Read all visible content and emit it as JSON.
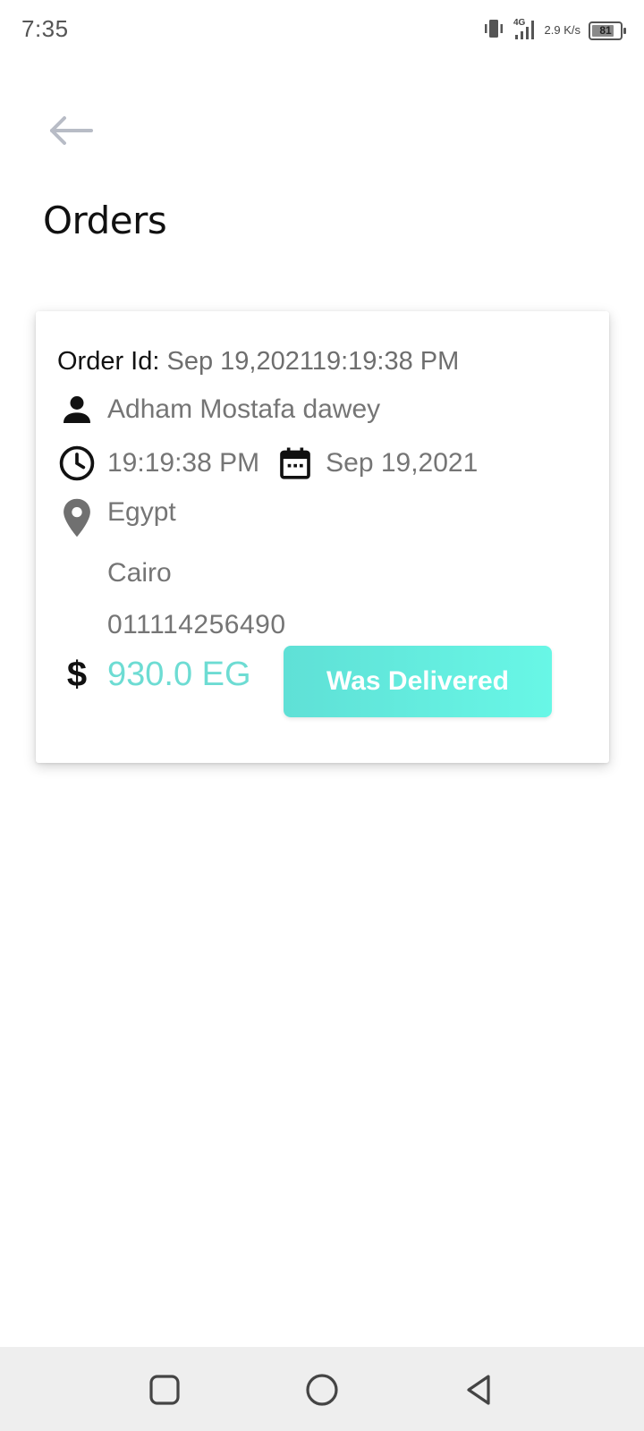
{
  "status_bar": {
    "time": "7:35",
    "network": "4G",
    "speed_value": "2.9",
    "speed_unit": "K/s",
    "battery_level": "81"
  },
  "header": {
    "back_icon": "arrow-left-icon",
    "title": "Orders"
  },
  "order": {
    "id_label": "Order Id:",
    "id_value": " Sep 19,202119:19:38 PM",
    "customer_name": "Adham Mostafa dawey",
    "time": "19:19:38 PM",
    "date": "Sep 19,2021",
    "country": "Egypt",
    "city": "Cairo",
    "phone": "011114256490",
    "currency_symbol": "$",
    "price": "930.0 EG",
    "status_label": "Was Delivered"
  },
  "icons": {
    "person": "person-icon",
    "clock": "clock-icon",
    "calendar": "calendar-icon",
    "location": "location-pin-icon",
    "dollar": "dollar-icon"
  },
  "colors": {
    "accent": "#6ddcd3",
    "button_gradient_start": "#5fe0d6",
    "button_gradient_end": "#68f7e6",
    "secondary_text": "#757575",
    "back_arrow": "#b8bcc6",
    "nav_bar": "#eeeeee"
  }
}
